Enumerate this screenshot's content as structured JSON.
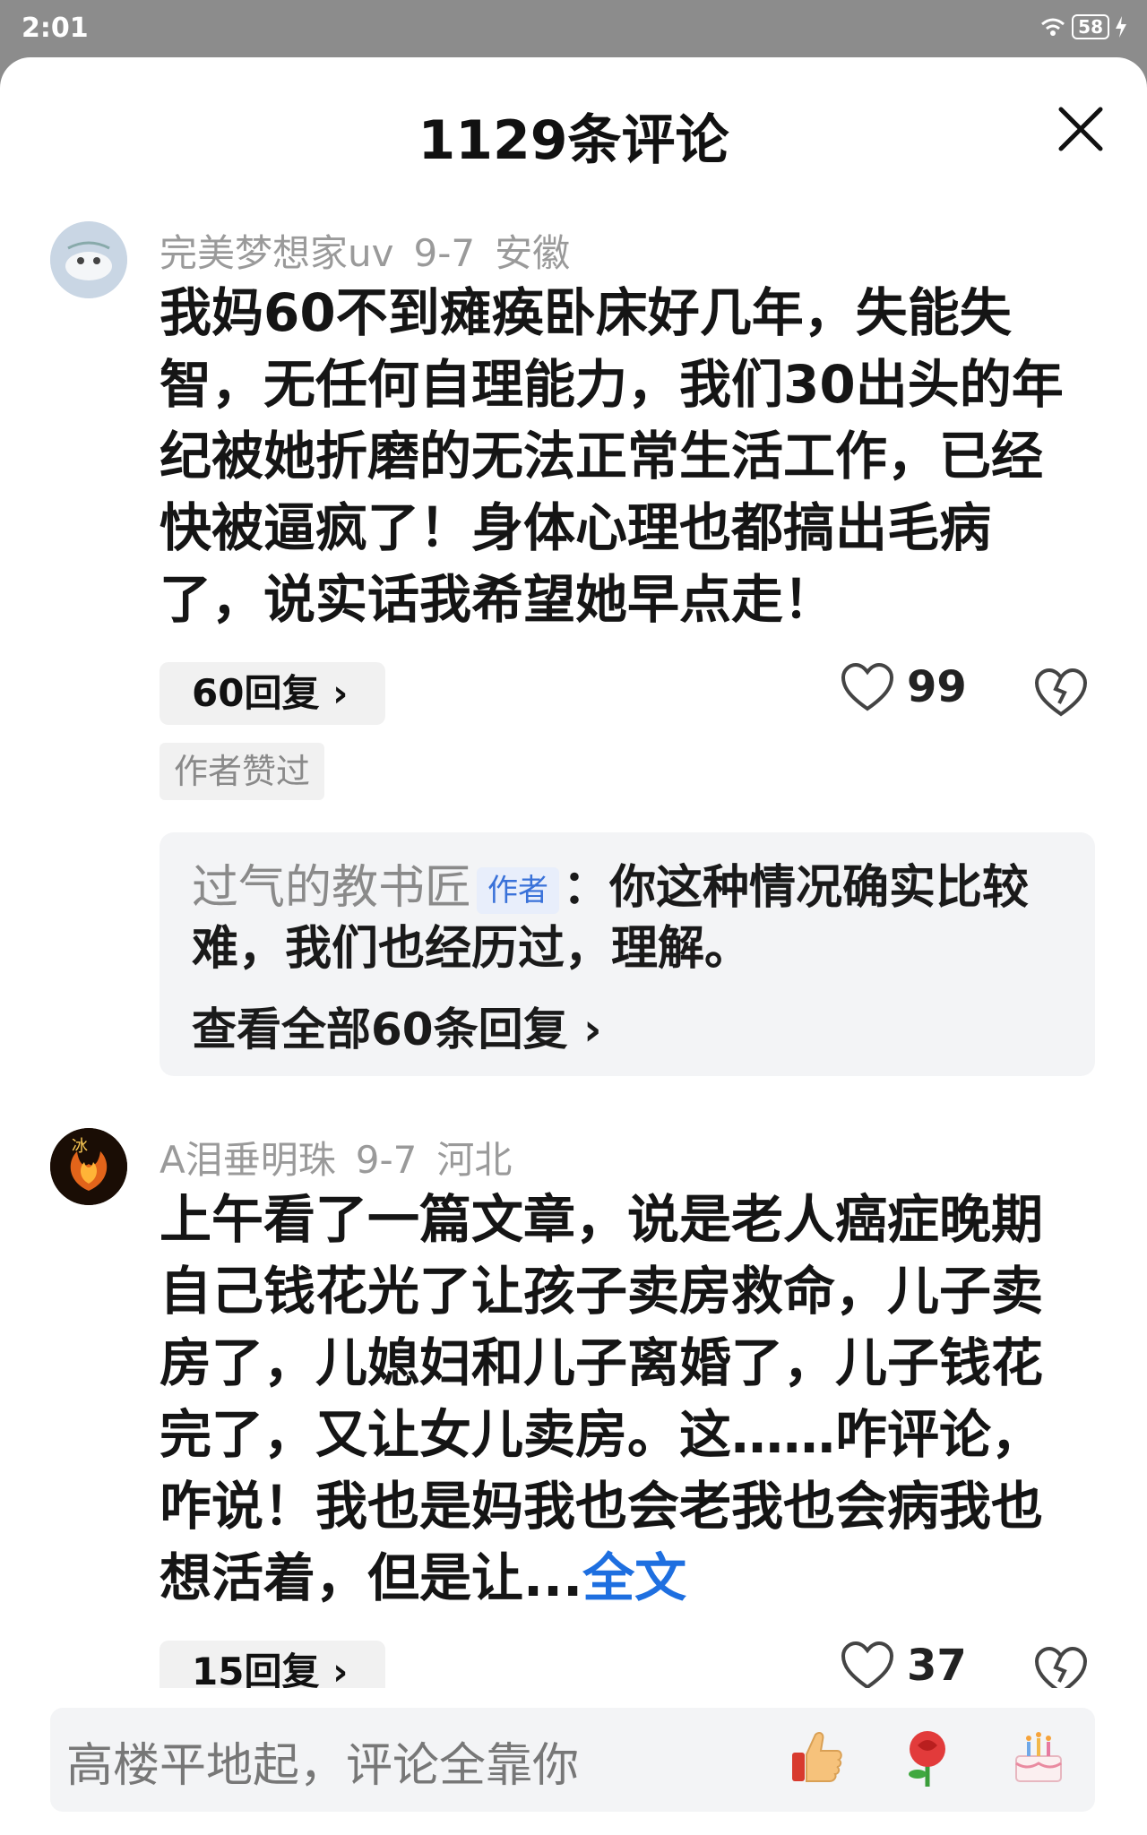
{
  "status_bar": {
    "time": "2:01",
    "battery": "58"
  },
  "sheet": {
    "title": "1129条评论"
  },
  "comments": [
    {
      "username": "完美梦想家uv",
      "date": "9-7",
      "location": "安徽",
      "content": "我妈60不到瘫痪卧床好几年，失能失智，无任何自理能力，我们30出头的年纪被她折磨的无法正常生活工作，已经快被逼疯了！身体心理也都搞出毛病了，说实话我希望她早点走！",
      "reply_count": "60回复",
      "likes": "99",
      "author_liked": "作者赞过",
      "top_reply": {
        "username": "过气的教书匠",
        "badge": "作者",
        "text": "：你这种情况确实比较难，我们也经历过，理解。"
      },
      "view_all": "查看全部60条回复"
    },
    {
      "username": "A泪垂明珠",
      "date": "9-7",
      "location": "河北",
      "content": "上午看了一篇文章，说是老人癌症晚期自己钱花光了让孩子卖房救命，儿子卖房了，儿媳妇和儿子离婚了，儿子钱花完了，又让女儿卖房。这……咋评论，咋说！我也是妈我也会老我也会病我也想活着，但是让...",
      "full_text_link": "全文",
      "reply_count": "15回复",
      "likes": "37"
    }
  ],
  "input": {
    "placeholder": "高楼平地起，评论全靠你"
  },
  "emoji_bar": [
    "thumbs-up-icon",
    "rose-icon",
    "cake-icon"
  ]
}
